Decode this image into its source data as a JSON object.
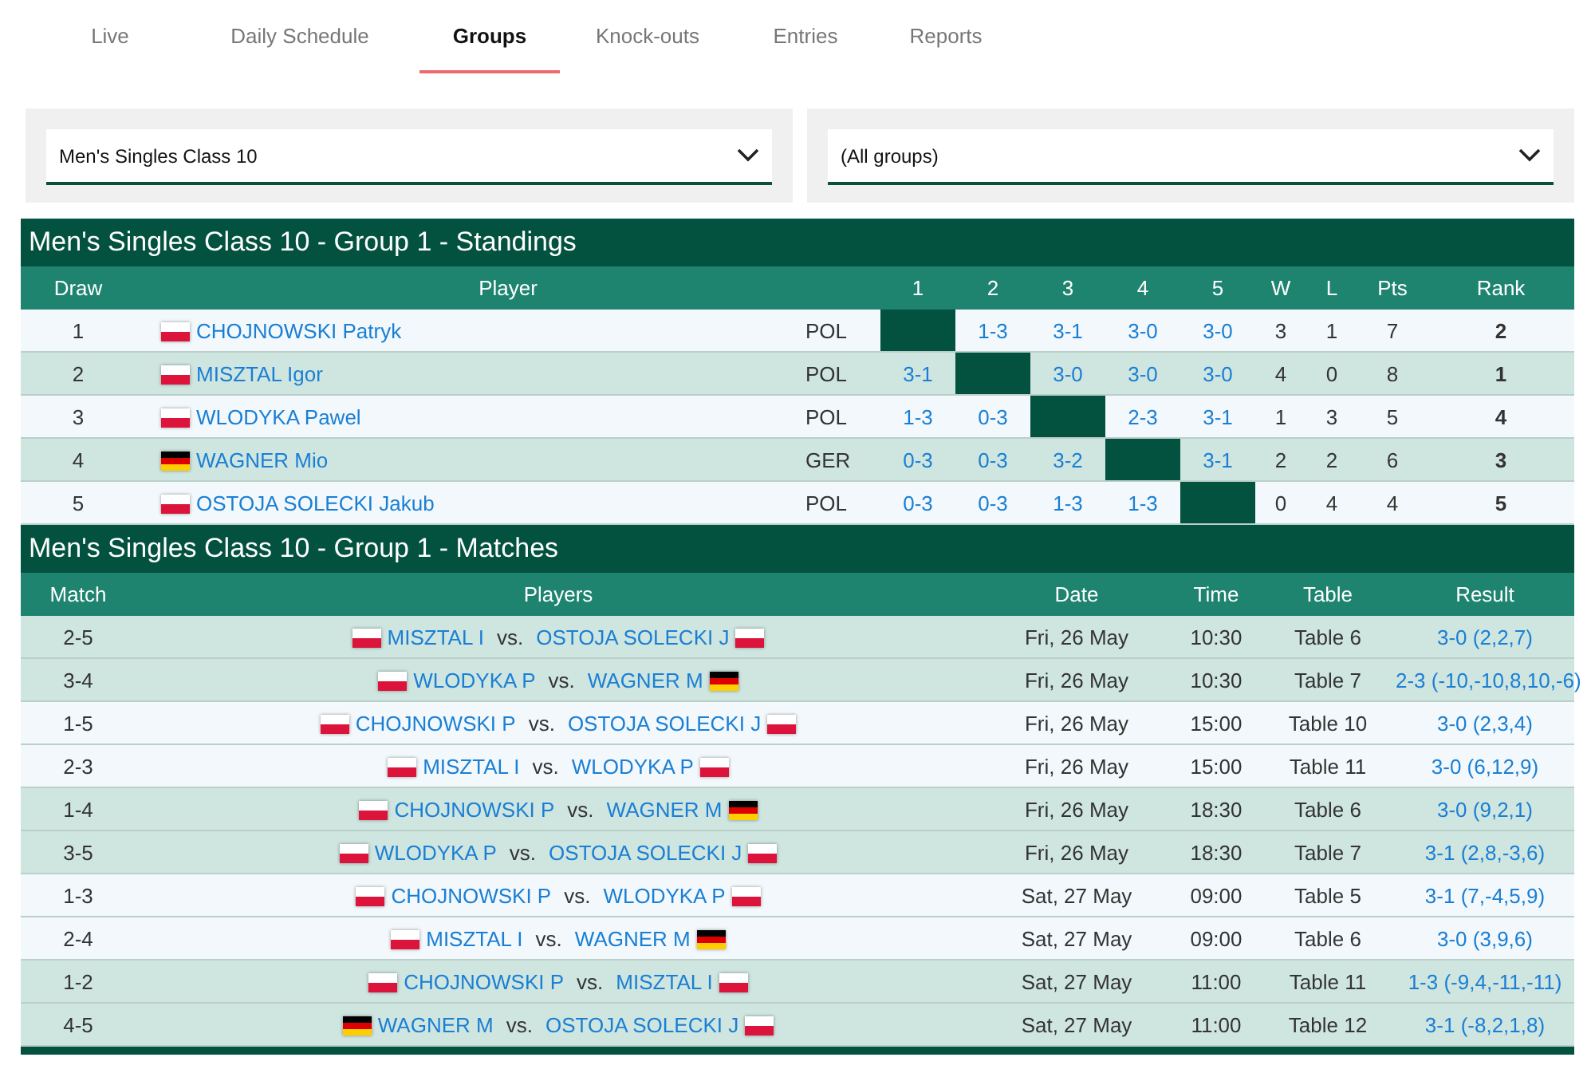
{
  "tabs": [
    {
      "label": "Live",
      "selected": false
    },
    {
      "label": "Daily Schedule",
      "selected": false
    },
    {
      "label": "Groups",
      "selected": true
    },
    {
      "label": "Knock-outs",
      "selected": false
    },
    {
      "label": "Entries",
      "selected": false
    },
    {
      "label": "Reports",
      "selected": false
    }
  ],
  "filters": [
    {
      "value": "Men's Singles Class 10"
    },
    {
      "value": "(All groups)"
    }
  ],
  "standings": {
    "title": "Men's Singles Class 10 - Group 1 - Standings",
    "columns": [
      "Draw",
      "Player",
      "1",
      "2",
      "3",
      "4",
      "5",
      "W",
      "L",
      "Pts",
      "Rank"
    ],
    "rows": [
      {
        "draw": "1",
        "kind": "poland",
        "player": "CHOJNOWSKI Patryk",
        "country": "POL",
        "results": [
          {
            "kind": "self"
          },
          {
            "kind": "score",
            "score": "1-3"
          },
          {
            "kind": "score",
            "score": "3-1"
          },
          {
            "kind": "score",
            "score": "3-0"
          },
          {
            "kind": "score",
            "score": "3-0"
          }
        ],
        "w": "3",
        "l": "1",
        "pts": "7",
        "rank": "2"
      },
      {
        "draw": "2",
        "kind": "poland",
        "player": "MISZTAL Igor",
        "country": "POL",
        "results": [
          {
            "kind": "score",
            "score": "3-1"
          },
          {
            "kind": "self"
          },
          {
            "kind": "score",
            "score": "3-0"
          },
          {
            "kind": "score",
            "score": "3-0"
          },
          {
            "kind": "score",
            "score": "3-0"
          }
        ],
        "w": "4",
        "l": "0",
        "pts": "8",
        "rank": "1"
      },
      {
        "draw": "3",
        "kind": "poland",
        "player": "WLODYKA Pawel",
        "country": "POL",
        "results": [
          {
            "kind": "score",
            "score": "1-3"
          },
          {
            "kind": "score",
            "score": "0-3"
          },
          {
            "kind": "self"
          },
          {
            "kind": "score",
            "score": "2-3"
          },
          {
            "kind": "score",
            "score": "3-1"
          }
        ],
        "w": "1",
        "l": "3",
        "pts": "5",
        "rank": "4"
      },
      {
        "draw": "4",
        "kind": "germany",
        "player": "WAGNER Mio",
        "country": "GER",
        "results": [
          {
            "kind": "score",
            "score": "0-3"
          },
          {
            "kind": "score",
            "score": "0-3"
          },
          {
            "kind": "score",
            "score": "3-2"
          },
          {
            "kind": "self"
          },
          {
            "kind": "score",
            "score": "3-1"
          }
        ],
        "w": "2",
        "l": "2",
        "pts": "6",
        "rank": "3"
      },
      {
        "draw": "5",
        "kind": "poland",
        "player": "OSTOJA SOLECKI Jakub",
        "country": "POL",
        "results": [
          {
            "kind": "score",
            "score": "0-3"
          },
          {
            "kind": "score",
            "score": "0-3"
          },
          {
            "kind": "score",
            "score": "1-3"
          },
          {
            "kind": "score",
            "score": "1-3"
          },
          {
            "kind": "self"
          }
        ],
        "w": "0",
        "l": "4",
        "pts": "4",
        "rank": "5"
      }
    ]
  },
  "matches": {
    "title": "Men's Singles Class 10 - Group 1 - Matches",
    "columns": [
      "Match",
      "Players",
      "Date",
      "Time",
      "Table",
      "Result"
    ],
    "rows": [
      {
        "match": "2-5",
        "players": [
          {
            "name": "MISZTAL I",
            "kind": "poland"
          },
          {
            "name": "OSTOJA SOLECKI J",
            "kind": "poland"
          }
        ],
        "vs": "vs.",
        "date": "Fri, 26 May",
        "time": "10:30",
        "table": "Table 6",
        "result": "3-0 (2,2,7)"
      },
      {
        "match": "3-4",
        "players": [
          {
            "name": "WLODYKA P",
            "kind": "poland"
          },
          {
            "name": "WAGNER M",
            "kind": "germany"
          }
        ],
        "vs": "vs.",
        "date": "Fri, 26 May",
        "time": "10:30",
        "table": "Table 7",
        "result": "2-3 (-10,-10,8,10,-6)"
      },
      {
        "match": "1-5",
        "players": [
          {
            "name": "CHOJNOWSKI P",
            "kind": "poland"
          },
          {
            "name": "OSTOJA SOLECKI J",
            "kind": "poland"
          }
        ],
        "vs": "vs.",
        "date": "Fri, 26 May",
        "time": "15:00",
        "table": "Table 10",
        "result": "3-0 (2,3,4)"
      },
      {
        "match": "2-3",
        "players": [
          {
            "name": "MISZTAL I",
            "kind": "poland"
          },
          {
            "name": "WLODYKA P",
            "kind": "poland"
          }
        ],
        "vs": "vs.",
        "date": "Fri, 26 May",
        "time": "15:00",
        "table": "Table 11",
        "result": "3-0 (6,12,9)"
      },
      {
        "match": "1-4",
        "players": [
          {
            "name": "CHOJNOWSKI P",
            "kind": "poland"
          },
          {
            "name": "WAGNER M",
            "kind": "germany"
          }
        ],
        "vs": "vs.",
        "date": "Fri, 26 May",
        "time": "18:30",
        "table": "Table 6",
        "result": "3-0 (9,2,1)"
      },
      {
        "match": "3-5",
        "players": [
          {
            "name": "WLODYKA P",
            "kind": "poland"
          },
          {
            "name": "OSTOJA SOLECKI J",
            "kind": "poland"
          }
        ],
        "vs": "vs.",
        "date": "Fri, 26 May",
        "time": "18:30",
        "table": "Table 7",
        "result": "3-1 (2,8,-3,6)"
      },
      {
        "match": "1-3",
        "players": [
          {
            "name": "CHOJNOWSKI P",
            "kind": "poland"
          },
          {
            "name": "WLODYKA P",
            "kind": "poland"
          }
        ],
        "vs": "vs.",
        "date": "Sat, 27 May",
        "time": "09:00",
        "table": "Table 5",
        "result": "3-1 (7,-4,5,9)"
      },
      {
        "match": "2-4",
        "players": [
          {
            "name": "MISZTAL I",
            "kind": "poland"
          },
          {
            "name": "WAGNER M",
            "kind": "germany"
          }
        ],
        "vs": "vs.",
        "date": "Sat, 27 May",
        "time": "09:00",
        "table": "Table 6",
        "result": "3-0 (3,9,6)"
      },
      {
        "match": "1-2",
        "players": [
          {
            "name": "CHOJNOWSKI P",
            "kind": "poland"
          },
          {
            "name": "MISZTAL I",
            "kind": "poland"
          }
        ],
        "vs": "vs.",
        "date": "Sat, 27 May",
        "time": "11:00",
        "table": "Table 11",
        "result": "1-3 (-9,4,-11,-11)"
      },
      {
        "match": "4-5",
        "players": [
          {
            "name": "WAGNER M",
            "kind": "germany"
          },
          {
            "name": "OSTOJA SOLECKI J",
            "kind": "poland"
          }
        ],
        "vs": "vs.",
        "date": "Sat, 27 May",
        "time": "11:00",
        "table": "Table 12",
        "result": "3-1 (-8,2,1,8)"
      }
    ]
  }
}
